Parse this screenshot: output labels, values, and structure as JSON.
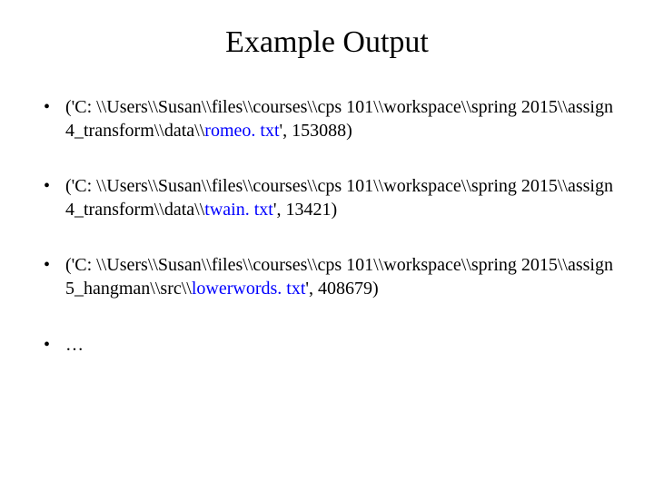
{
  "title": "Example Output",
  "items": [
    {
      "pre": "('C: \\\\Users\\\\Susan\\\\files\\\\courses\\\\cps 101\\\\workspace\\\\spring 2015\\\\assign 4_transform\\\\data\\\\",
      "filename": "romeo. txt",
      "post": "', 153088)"
    },
    {
      "pre": "('C: \\\\Users\\\\Susan\\\\files\\\\courses\\\\cps 101\\\\workspace\\\\spring 2015\\\\assign 4_transform\\\\data\\\\",
      "filename": "twain. txt",
      "post": "', 13421)"
    },
    {
      "pre": "('C: \\\\Users\\\\Susan\\\\files\\\\courses\\\\cps 101\\\\workspace\\\\spring 2015\\\\assign 5_hangman\\\\src\\\\",
      "filename": "lowerwords. txt",
      "post": "', 408679)"
    },
    {
      "pre": "…",
      "filename": "",
      "post": ""
    }
  ]
}
